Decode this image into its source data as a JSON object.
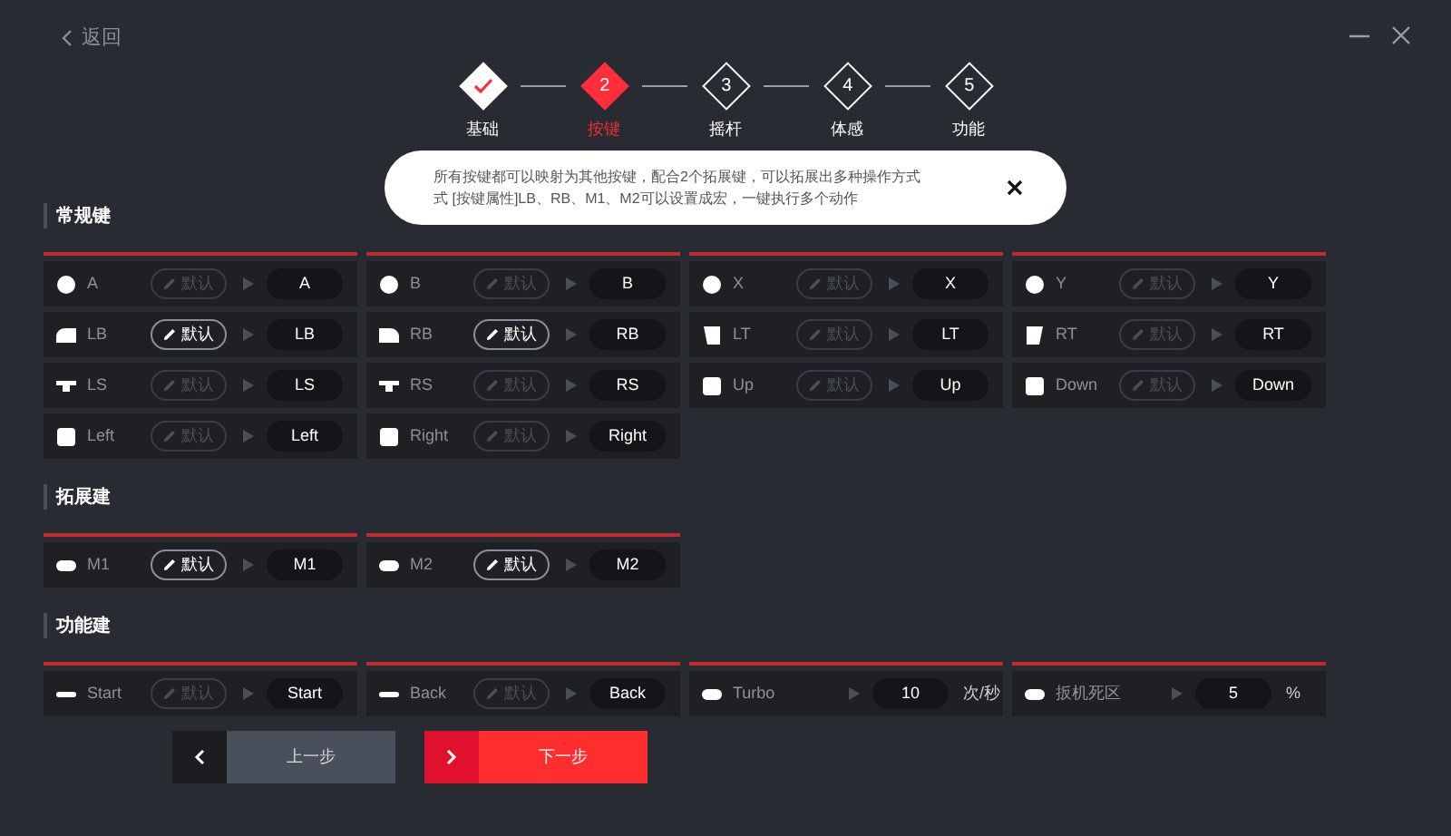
{
  "header": {
    "back": "返回"
  },
  "steps": [
    {
      "label": "基础",
      "done": true,
      "selected": false
    },
    {
      "number": "2",
      "label": "按键",
      "done": false,
      "selected": true
    },
    {
      "number": "3",
      "label": "摇杆",
      "done": false,
      "selected": false
    },
    {
      "number": "4",
      "label": "体感",
      "done": false,
      "selected": false
    },
    {
      "number": "5",
      "label": "功能",
      "done": false,
      "selected": false
    }
  ],
  "tooltip": {
    "lines": [
      "所有按键都可以映射为其他按键，配合2个拓展键，可以拓展出多种操作方式",
      "式 [按键属性]LB、RB、M1、M2可以设置成宏，一键执行多个动作"
    ]
  },
  "sections": [
    {
      "title": "常规键",
      "columns": [
        [
          {
            "kind": "circle",
            "name": "A",
            "default": "默认",
            "editable": false,
            "target": "A"
          },
          {
            "kind": "bumper_left",
            "name": "LB",
            "default": "默认",
            "editable": true,
            "target": "LB"
          },
          {
            "kind": "stick",
            "name": "LS",
            "default": "默认",
            "editable": false,
            "target": "LS"
          },
          {
            "kind": "square",
            "name": "Left",
            "default": "默认",
            "editable": false,
            "target": "Left"
          }
        ],
        [
          {
            "kind": "circle",
            "name": "B",
            "default": "默认",
            "editable": false,
            "target": "B"
          },
          {
            "kind": "bumper_right",
            "name": "RB",
            "default": "默认",
            "editable": true,
            "target": "RB"
          },
          {
            "kind": "stick",
            "name": "RS",
            "default": "默认",
            "editable": false,
            "target": "RS"
          },
          {
            "kind": "square",
            "name": "Right",
            "default": "默认",
            "editable": false,
            "target": "Right"
          }
        ],
        [
          {
            "kind": "circle",
            "name": "X",
            "default": "默认",
            "editable": false,
            "target": "X"
          },
          {
            "kind": "trigger_left",
            "name": "LT",
            "default": "默认",
            "editable": false,
            "target": "LT"
          },
          {
            "kind": "square",
            "name": "Up",
            "default": "默认",
            "editable": false,
            "target": "Up"
          }
        ],
        [
          {
            "kind": "circle",
            "name": "Y",
            "default": "默认",
            "editable": false,
            "target": "Y"
          },
          {
            "kind": "trigger_right",
            "name": "RT",
            "default": "默认",
            "editable": false,
            "target": "RT"
          },
          {
            "kind": "square",
            "name": "Down",
            "default": "默认",
            "editable": false,
            "target": "Down"
          }
        ]
      ]
    },
    {
      "title": "拓展建",
      "columns": [
        [
          {
            "kind": "pill",
            "name": "M1",
            "default": "默认",
            "editable": true,
            "target": "M1"
          }
        ],
        [
          {
            "kind": "pill",
            "name": "M2",
            "default": "默认",
            "editable": true,
            "target": "M2"
          }
        ]
      ]
    },
    {
      "title": "功能建",
      "columns": [
        [
          {
            "kind": "dash",
            "name": "Start",
            "default": "默认",
            "editable": false,
            "target": "Start"
          }
        ],
        [
          {
            "kind": "dash",
            "name": "Back",
            "default": "默认",
            "editable": false,
            "target": "Back"
          }
        ],
        [
          {
            "kind": "value",
            "name": "Turbo",
            "value": "10",
            "unit": "次/秒"
          }
        ],
        [
          {
            "kind": "value",
            "name": "扳机死区",
            "value": "5",
            "unit": "%"
          }
        ]
      ]
    }
  ],
  "nav": [
    {
      "kind": "prev",
      "label": "上一步"
    },
    {
      "kind": "next",
      "label": "下一步"
    }
  ]
}
